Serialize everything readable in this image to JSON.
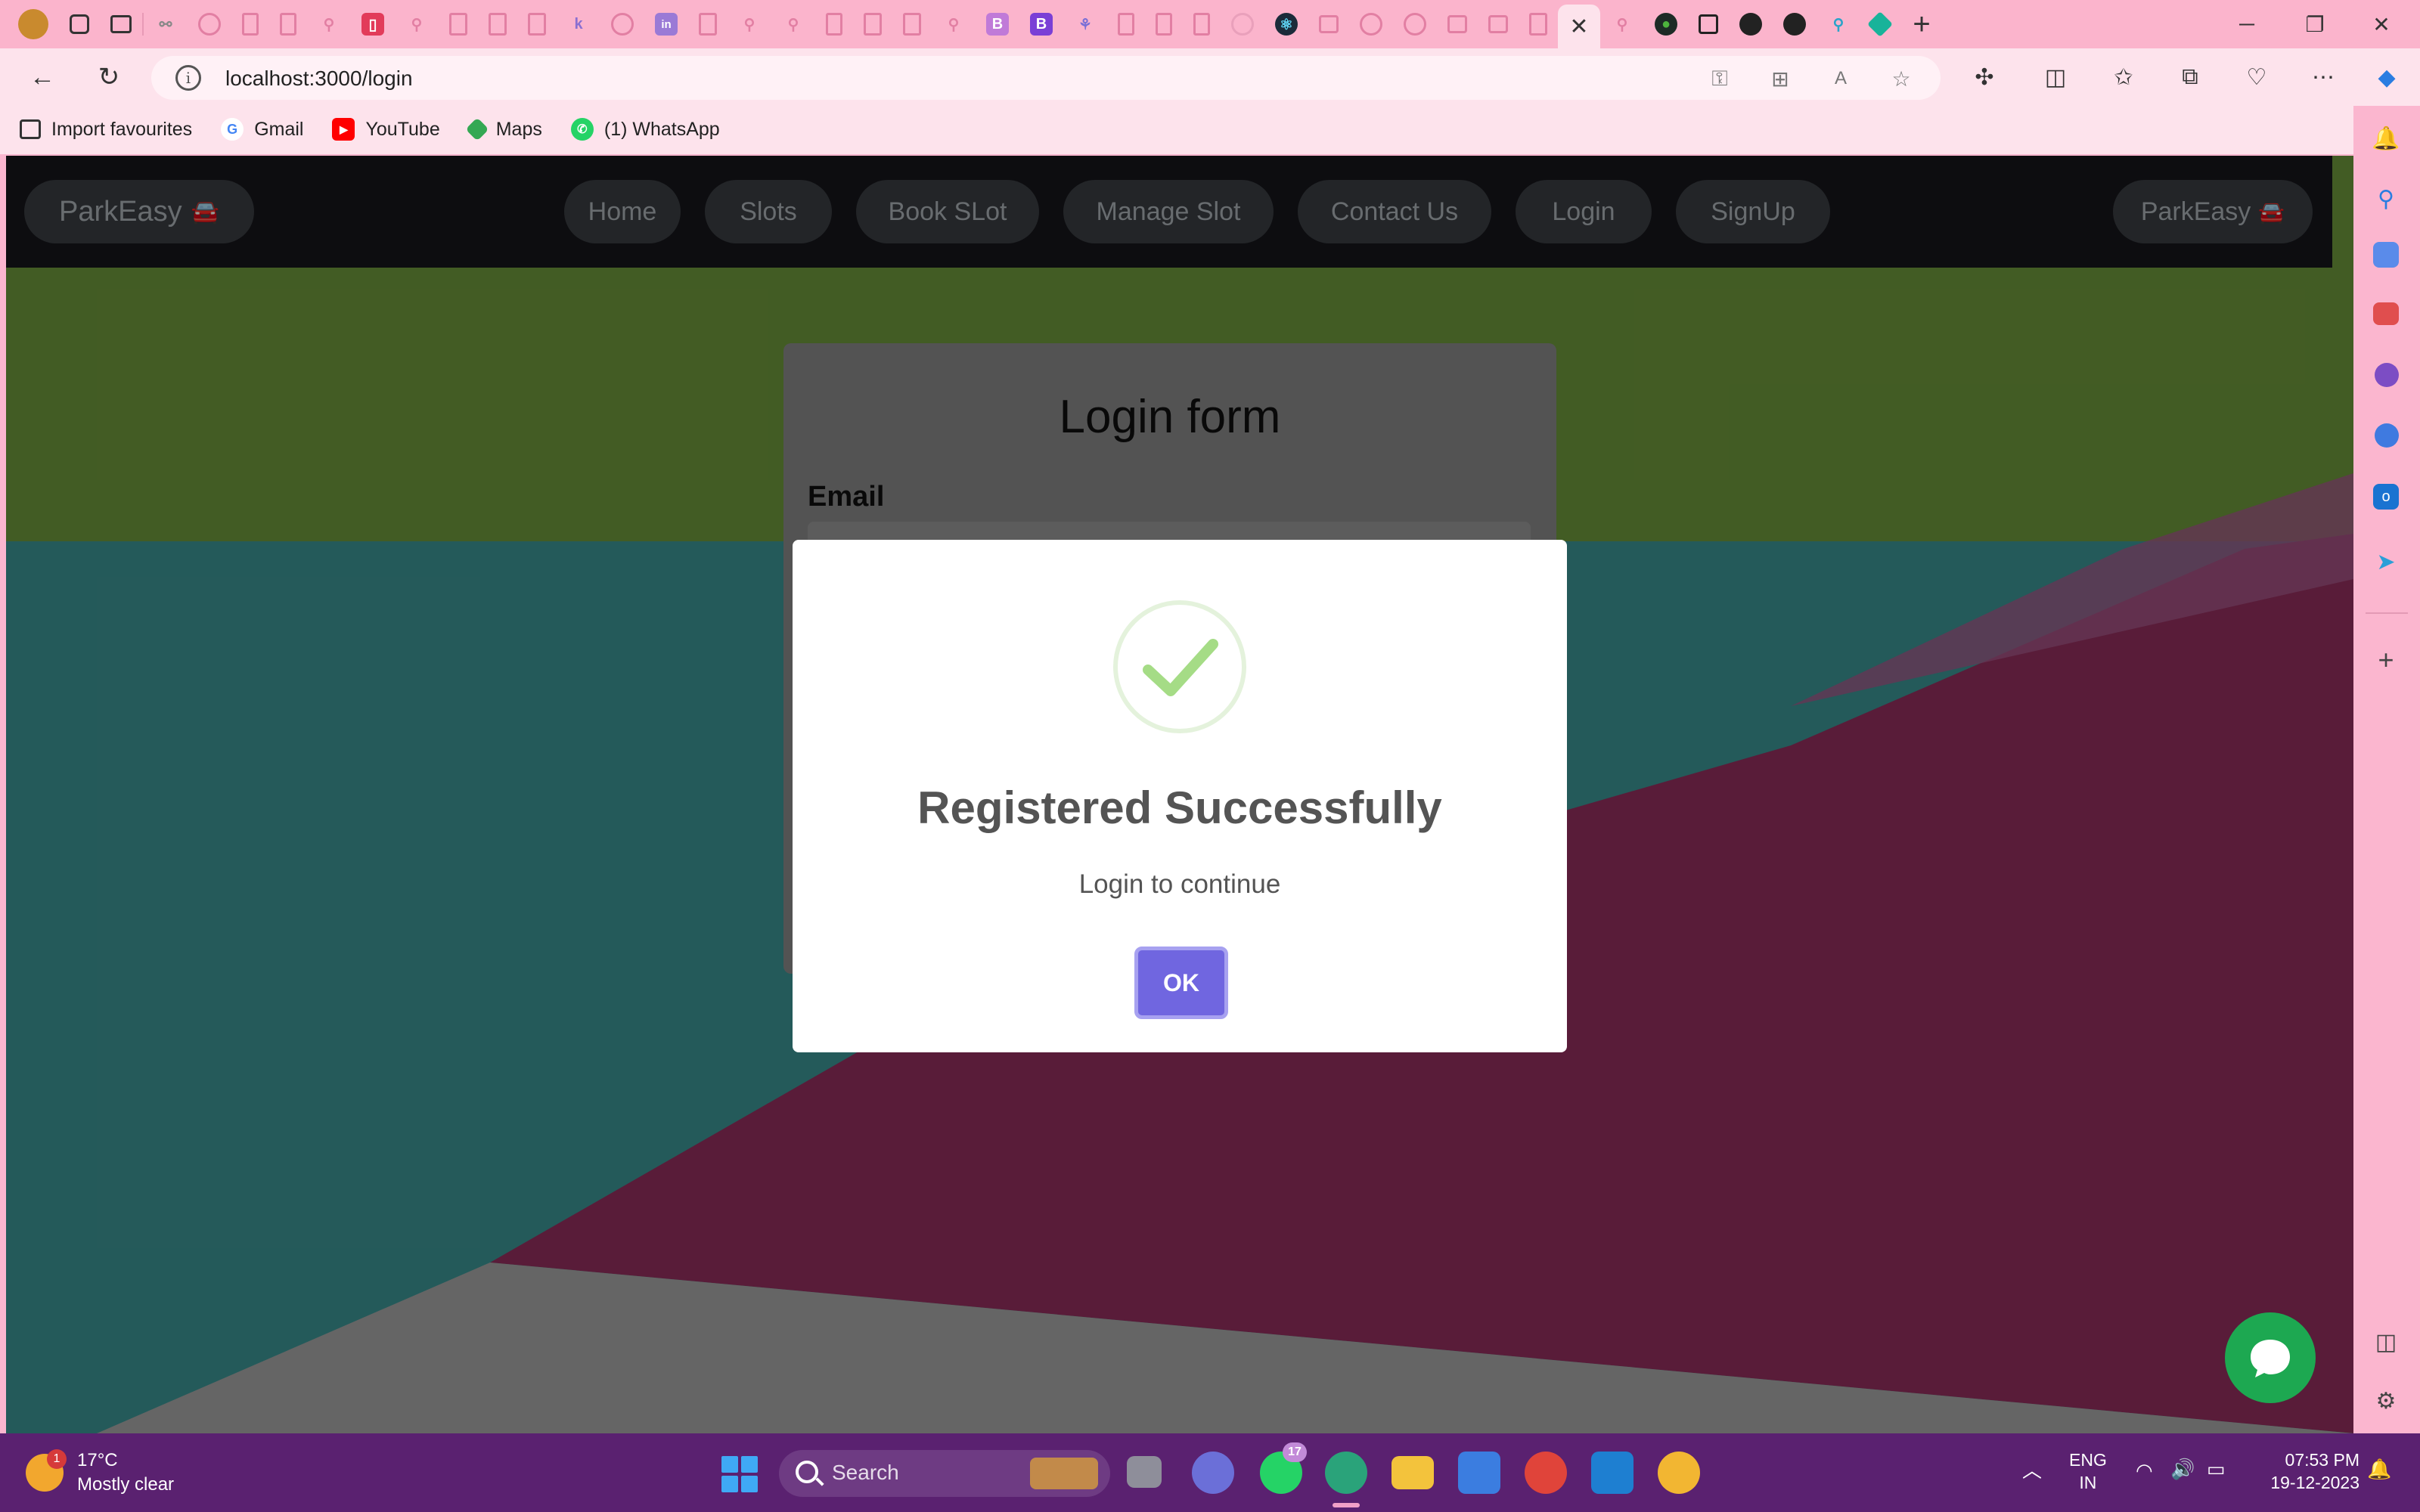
{
  "browser": {
    "url": "localhost:3000/login",
    "favourites": [
      {
        "label": "Import favourites",
        "icon": "import-icon"
      },
      {
        "label": "Gmail",
        "icon": "google-icon"
      },
      {
        "label": "YouTube",
        "icon": "youtube-icon"
      },
      {
        "label": "Maps",
        "icon": "maps-icon"
      },
      {
        "label": "(1) WhatsApp",
        "icon": "whatsapp-icon"
      }
    ],
    "tab_badges": {
      "b1": "B",
      "b2": "B",
      "k": "k",
      "in": "in"
    }
  },
  "site": {
    "brand": "ParkEasy",
    "brand_right": "ParkEasy",
    "nav": [
      "Home",
      "Slots",
      "Book SLot",
      "Manage Slot",
      "Contact Us",
      "Login",
      "SignUp"
    ]
  },
  "login_form": {
    "title": "Login form",
    "email_label": "Email"
  },
  "dialog": {
    "title": "Registered Successfully",
    "message": "Login to continue",
    "ok_label": "OK",
    "accent": "#7066e0",
    "icon": "success-check-icon"
  },
  "colors": {
    "nav_bg": "#16161b",
    "bg_olive": "#6f9a3c",
    "bg_teal": "#3d9696",
    "bg_maroon": "#94305f",
    "card_gray": "#8b8b8b"
  },
  "taskbar": {
    "temperature": "17°C",
    "weather": "Mostly clear",
    "weather_badge": "1",
    "search_placeholder": "Search",
    "whatsapp_badge": "17",
    "lang_line1": "ENG",
    "lang_line2": "IN",
    "time": "07:53 PM",
    "date": "19-12-2023"
  }
}
